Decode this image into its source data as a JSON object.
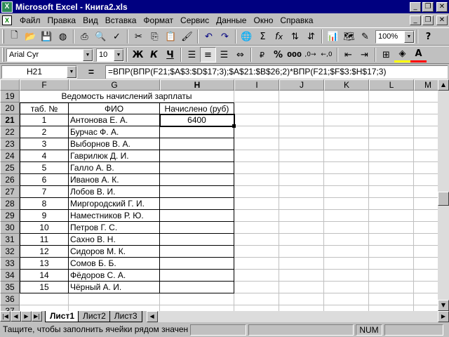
{
  "window": {
    "title": "Microsoft Excel - Книга2.xls",
    "icon": "excel-icon",
    "controls": {
      "minimize": "_",
      "maximize": "❐",
      "close": "✕"
    }
  },
  "menu": {
    "items": [
      "Файл",
      "Правка",
      "Вид",
      "Вставка",
      "Формат",
      "Сервис",
      "Данные",
      "Окно",
      "Справка"
    ]
  },
  "toolbar_standard": {
    "buttons": [
      "new-icon",
      "open-icon",
      "save-icon",
      "print-icon",
      "print-preview-icon",
      "spelling-icon",
      "cut-icon",
      "copy-icon",
      "paste-icon",
      "format-painter-icon",
      "undo-icon",
      "redo-icon",
      "hyperlink-icon",
      "autosum-icon",
      "function-icon",
      "sort-asc-icon",
      "sort-desc-icon",
      "chart-wizard-icon",
      "drawing-icon"
    ],
    "zoom": "100%",
    "help": "?"
  },
  "toolbar_formatting": {
    "font": "Arial Cyr",
    "size": "10",
    "bold": "Ж",
    "italic": "К",
    "underline": "Ч",
    "percent": "%",
    "thousands": "000",
    "currency": "₽"
  },
  "formula_bar": {
    "name_box": "H21",
    "equals": "=",
    "formula": "=ВПР(ВПР(F21;$A$3:$D$17;3);$A$21:$B$26;2)*ВПР(F21;$F$3:$H$17;3)"
  },
  "grid": {
    "columns": [
      "F",
      "G",
      "H",
      "I",
      "J",
      "K",
      "L",
      "M"
    ],
    "active_column": "H",
    "first_row": 19,
    "active_row": 21,
    "title": "Ведомость начислений зарплаты",
    "headers": {
      "tab": "таб. №",
      "name": "ФИО",
      "accrued": "Начислено (руб)"
    },
    "rows": [
      {
        "num": "1",
        "name": "Антонова Е. А.",
        "value": "6400"
      },
      {
        "num": "2",
        "name": "Бурчас Ф. А.",
        "value": ""
      },
      {
        "num": "3",
        "name": "Выборнов В. А.",
        "value": ""
      },
      {
        "num": "4",
        "name": "Гаврилюк Д. И.",
        "value": ""
      },
      {
        "num": "5",
        "name": "Галло А. В.",
        "value": ""
      },
      {
        "num": "6",
        "name": "Иванов А. К.",
        "value": ""
      },
      {
        "num": "7",
        "name": "Лобов В. И.",
        "value": ""
      },
      {
        "num": "8",
        "name": "Миргородский Г. И.",
        "value": ""
      },
      {
        "num": "9",
        "name": "Наместников Р. Ю.",
        "value": ""
      },
      {
        "num": "10",
        "name": "Петров Г. С.",
        "value": ""
      },
      {
        "num": "11",
        "name": "Сахно В. Н.",
        "value": ""
      },
      {
        "num": "12",
        "name": "Сидоров М. К.",
        "value": ""
      },
      {
        "num": "13",
        "name": "Сомов Б. Б.",
        "value": ""
      },
      {
        "num": "14",
        "name": "Фёдоров С. А.",
        "value": ""
      },
      {
        "num": "15",
        "name": "Чёрный А. И.",
        "value": ""
      }
    ],
    "extra_rows": [
      "36",
      "37"
    ]
  },
  "sheets": {
    "tabs": [
      "Лист1",
      "Лист2",
      "Лист3"
    ],
    "active": "Лист1"
  },
  "status": {
    "message": "Тащите, чтобы заполнить ячейки рядом значениями",
    "num": "NUM"
  }
}
